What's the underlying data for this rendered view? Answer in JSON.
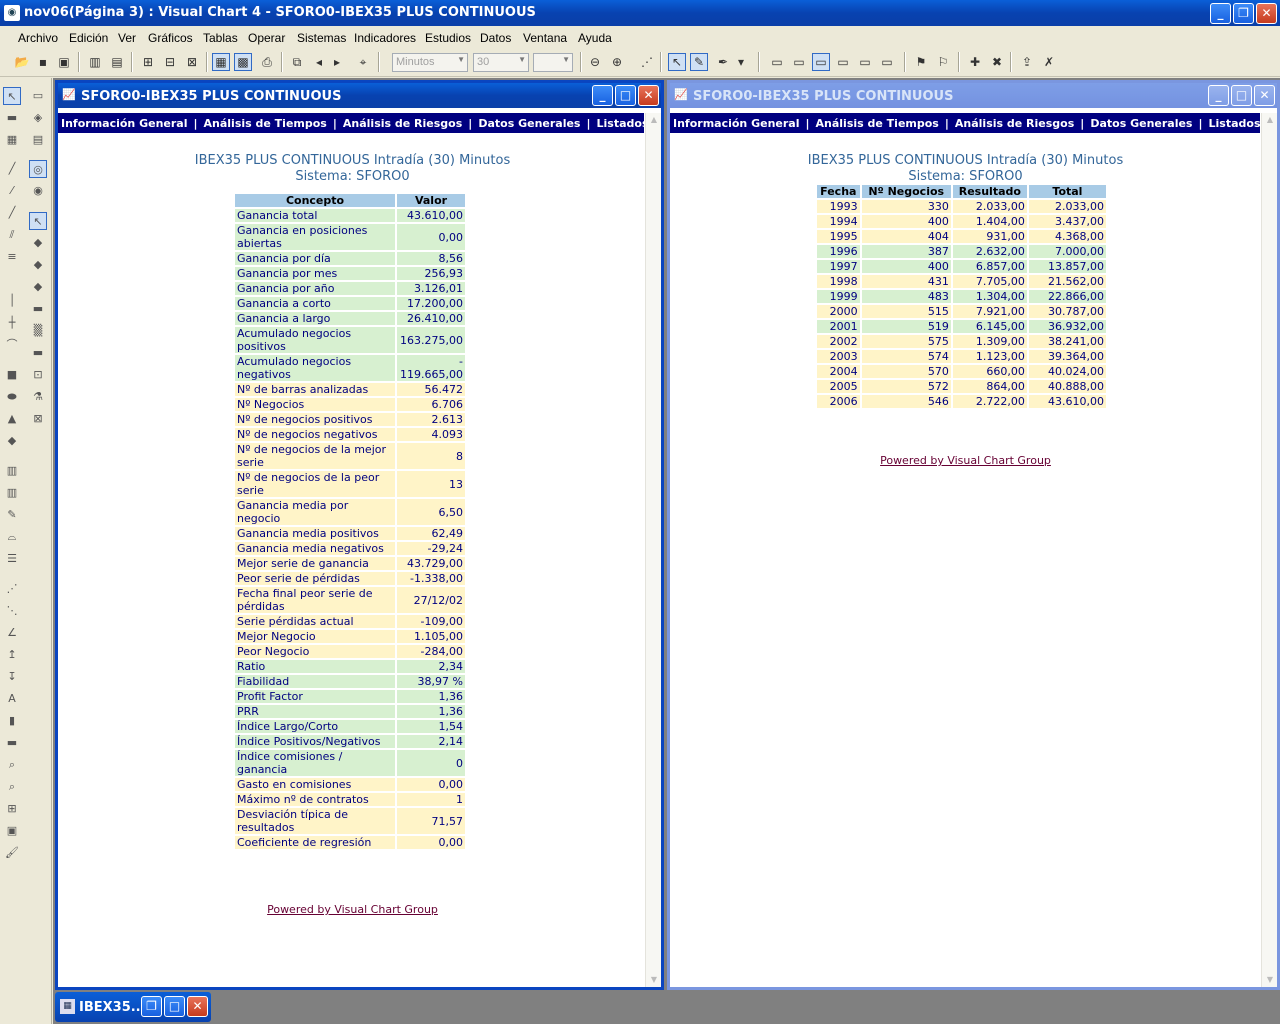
{
  "app": {
    "title": "nov06(Página 3) : Visual Chart 4 - SFORO0-IBEX35 PLUS CONTINUOUS"
  },
  "menu": [
    "Archivo",
    "Edición",
    "Ver",
    "Gráficos",
    "Tablas",
    "Operar",
    "Sistemas",
    "Indicadores",
    "Estudios",
    "Datos",
    "Ventana",
    "Ayuda"
  ],
  "toolbar": {
    "interval_combo": "Minutos",
    "period_combo": "30",
    "third_combo": ""
  },
  "nav_links": [
    "Información General",
    "Análisis de Tiempos",
    "Análisis de Riesgos",
    "Datos Generales",
    "Listados"
  ],
  "left_window": {
    "title": "SFORO0-IBEX35 PLUS CONTINUOUS",
    "report_line1": "IBEX35 PLUS CONTINUOUS Intradía (30) Minutos",
    "report_line2": "Sistema: SFORO0",
    "col_concept": "Concepto",
    "col_value": "Valor",
    "rows": [
      {
        "c": "Ganancia total",
        "v": "43.610,00",
        "t": "g"
      },
      {
        "c": "Ganancia en posiciones abiertas",
        "v": "0,00",
        "t": "g"
      },
      {
        "c": "Ganancia por día",
        "v": "8,56",
        "t": "g"
      },
      {
        "c": "Ganancia por mes",
        "v": "256,93",
        "t": "g"
      },
      {
        "c": "Ganancia por año",
        "v": "3.126,01",
        "t": "g"
      },
      {
        "c": "Ganancia a corto",
        "v": "17.200,00",
        "t": "g"
      },
      {
        "c": "Ganancia a largo",
        "v": "26.410,00",
        "t": "g"
      },
      {
        "c": "Acumulado negocios positivos",
        "v": "163.275,00",
        "t": "g"
      },
      {
        "c": "Acumulado negocios negativos",
        "v": "- 119.665,00",
        "t": "g"
      },
      {
        "c": "Nº de barras analizadas",
        "v": "56.472",
        "t": "y"
      },
      {
        "c": "Nº Negocios",
        "v": "6.706",
        "t": "y"
      },
      {
        "c": "Nº de negocios positivos",
        "v": "2.613",
        "t": "y"
      },
      {
        "c": "Nº de negocios negativos",
        "v": "4.093",
        "t": "y"
      },
      {
        "c": "Nº de negocios de la mejor serie",
        "v": "8",
        "t": "y"
      },
      {
        "c": "Nº de negocios de la peor serie",
        "v": "13",
        "t": "y"
      },
      {
        "c": "Ganancia media por negocio",
        "v": "6,50",
        "t": "y"
      },
      {
        "c": "Ganancia media positivos",
        "v": "62,49",
        "t": "y"
      },
      {
        "c": "Ganancia media negativos",
        "v": "-29,24",
        "t": "y"
      },
      {
        "c": "Mejor serie de ganancia",
        "v": "43.729,00",
        "t": "y"
      },
      {
        "c": "Peor serie de pérdidas",
        "v": "-1.338,00",
        "t": "y"
      },
      {
        "c": "Fecha final peor serie de pérdidas",
        "v": "27/12/02",
        "t": "y"
      },
      {
        "c": "Serie pérdidas actual",
        "v": "-109,00",
        "t": "y"
      },
      {
        "c": "Mejor Negocio",
        "v": "1.105,00",
        "t": "y"
      },
      {
        "c": "Peor Negocio",
        "v": "-284,00",
        "t": "y"
      },
      {
        "c": "Ratio",
        "v": "2,34",
        "t": "g"
      },
      {
        "c": "Fiabilidad",
        "v": "38,97 %",
        "t": "g"
      },
      {
        "c": "Profit Factor",
        "v": "1,36",
        "t": "g"
      },
      {
        "c": "PRR",
        "v": "1,36",
        "t": "g"
      },
      {
        "c": "Índice Largo/Corto",
        "v": "1,54",
        "t": "g"
      },
      {
        "c": "Índice Positivos/Negativos",
        "v": "2,14",
        "t": "g"
      },
      {
        "c": "Índice comisiones / ganancia",
        "v": "0",
        "t": "g"
      },
      {
        "c": "Gasto en comisiones",
        "v": "0,00",
        "t": "y"
      },
      {
        "c": "Máximo nº de contratos",
        "v": "1",
        "t": "y"
      },
      {
        "c": "Desviación típica de resultados",
        "v": "71,57",
        "t": "y"
      },
      {
        "c": "Coeficiente de regresión",
        "v": "0,00",
        "t": "y"
      }
    ],
    "powered": "Powered by Visual Chart Group"
  },
  "right_window": {
    "title": "SFORO0-IBEX35 PLUS CONTINUOUS",
    "report_line1": "IBEX35 PLUS CONTINUOUS Intradía (30) Minutos",
    "report_line2": "Sistema: SFORO0",
    "headers": [
      "Fecha",
      "Nº Negocios",
      "Resultado",
      "Total"
    ],
    "rows": [
      {
        "f": "1993",
        "n": "330",
        "r": "2.033,00",
        "t": "2.033,00",
        "k": "y"
      },
      {
        "f": "1994",
        "n": "400",
        "r": "1.404,00",
        "t": "3.437,00",
        "k": "y"
      },
      {
        "f": "1995",
        "n": "404",
        "r": "931,00",
        "t": "4.368,00",
        "k": "y"
      },
      {
        "f": "1996",
        "n": "387",
        "r": "2.632,00",
        "t": "7.000,00",
        "k": "g"
      },
      {
        "f": "1997",
        "n": "400",
        "r": "6.857,00",
        "t": "13.857,00",
        "k": "g"
      },
      {
        "f": "1998",
        "n": "431",
        "r": "7.705,00",
        "t": "21.562,00",
        "k": "y"
      },
      {
        "f": "1999",
        "n": "483",
        "r": "1.304,00",
        "t": "22.866,00",
        "k": "g"
      },
      {
        "f": "2000",
        "n": "515",
        "r": "7.921,00",
        "t": "30.787,00",
        "k": "y"
      },
      {
        "f": "2001",
        "n": "519",
        "r": "6.145,00",
        "t": "36.932,00",
        "k": "g"
      },
      {
        "f": "2002",
        "n": "575",
        "r": "1.309,00",
        "t": "38.241,00",
        "k": "y"
      },
      {
        "f": "2003",
        "n": "574",
        "r": "1.123,00",
        "t": "39.364,00",
        "k": "y"
      },
      {
        "f": "2004",
        "n": "570",
        "r": "660,00",
        "t": "40.024,00",
        "k": "y"
      },
      {
        "f": "2005",
        "n": "572",
        "r": "864,00",
        "t": "40.888,00",
        "k": "y"
      },
      {
        "f": "2006",
        "n": "546",
        "r": "2.722,00",
        "t": "43.610,00",
        "k": "y"
      }
    ],
    "powered": "Powered by Visual Chart Group"
  },
  "taskbar": {
    "minimized_label": "IBEX35..."
  }
}
